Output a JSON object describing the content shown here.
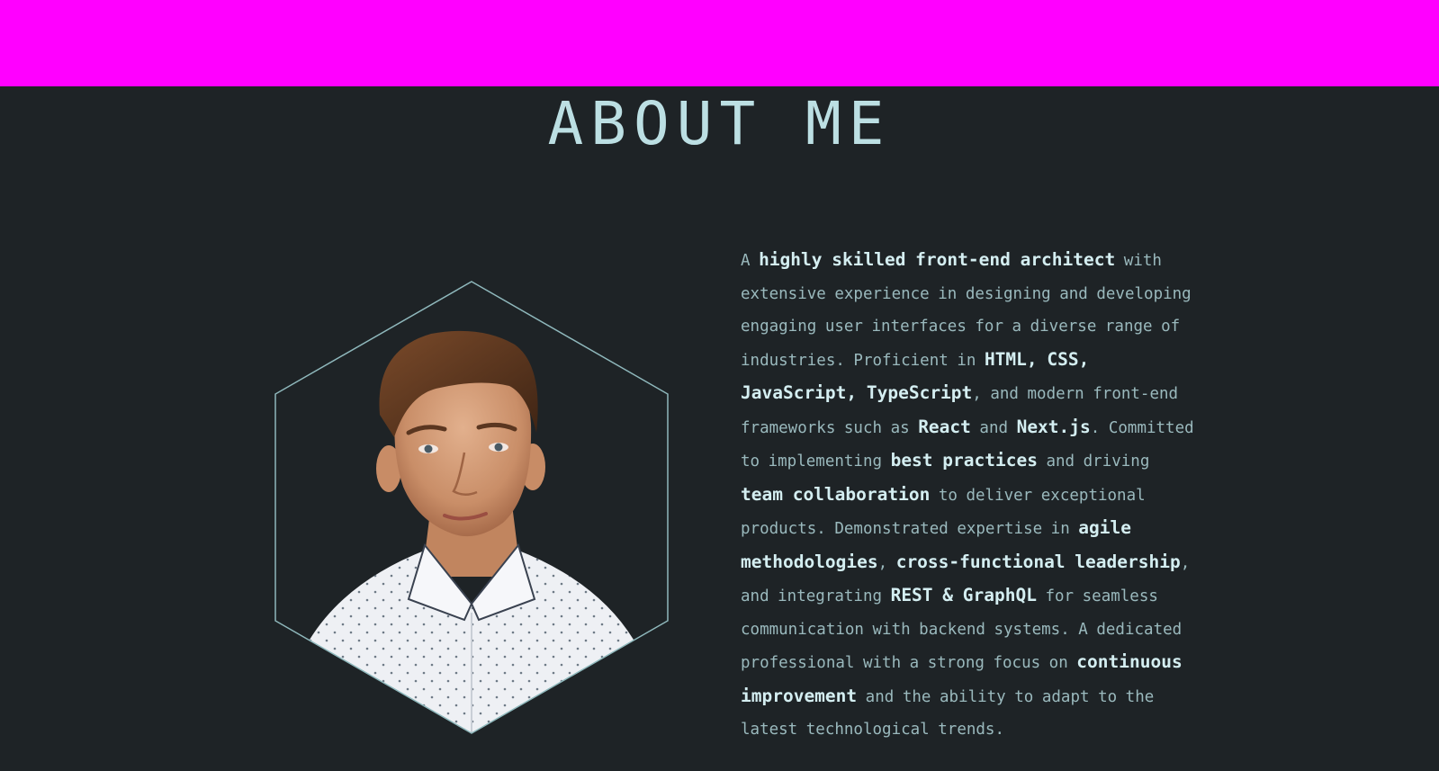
{
  "section": {
    "title": "ABOUT ME"
  },
  "colors": {
    "header_bar": "#ff00ff",
    "background": "#1e2326",
    "accent_text": "#bcdfe3",
    "body_text": "#9ab9bd",
    "highlight_text": "#d4eef1"
  },
  "portrait": {
    "icon": "profile-photo",
    "frame": "hexagon-outline"
  },
  "about": {
    "s1": "A ",
    "h1": "highly skilled front-end architect",
    "s2": " with extensive experience in designing and developing engaging user interfaces for a diverse range of industries. Proficient in ",
    "h2": "HTML, CSS, JavaScript, TypeScript",
    "s3": ", and modern front-end frameworks such as ",
    "h3": "React",
    "s4": " and ",
    "h4": "Next.js",
    "s5": ". Committed to implementing ",
    "h5": "best practices",
    "s6": " and driving ",
    "h6": "team collaboration",
    "s7": " to deliver exceptional products. Demonstrated expertise in ",
    "h7": "agile methodologies",
    "s8": ", ",
    "h8": "cross-functional leadership",
    "s9": ", and integrating ",
    "h9": "REST & GraphQL",
    "s10": " for seamless communication with backend systems. A dedicated professional with a strong focus on ",
    "h10": "continuous improvement",
    "s11": " and the ability to adapt to the latest technological trends."
  }
}
